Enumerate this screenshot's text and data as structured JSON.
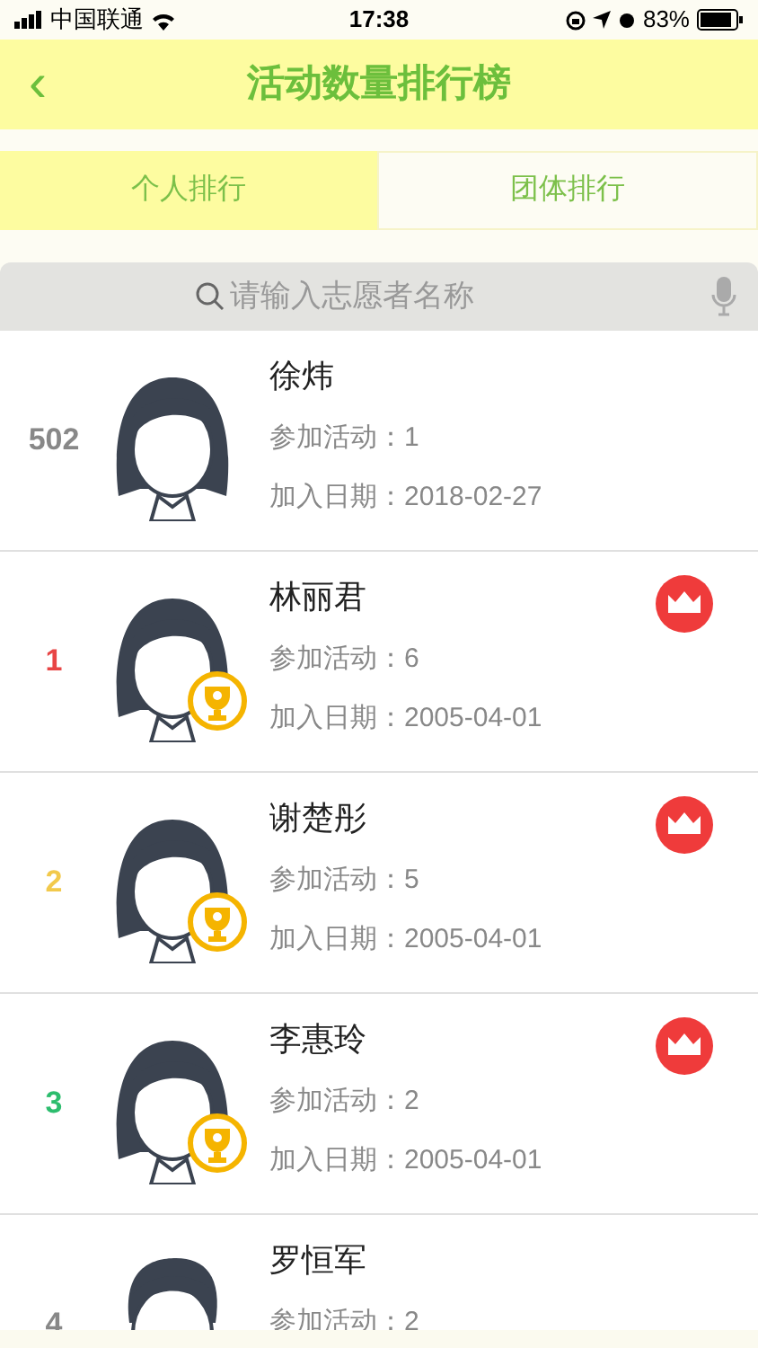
{
  "status_bar": {
    "carrier": "中国联通",
    "time": "17:38",
    "battery": "83%"
  },
  "header": {
    "back": "‹",
    "title": "活动数量排行榜"
  },
  "tabs": [
    {
      "label": "个人排行",
      "selected": true
    },
    {
      "label": "团体排行",
      "selected": false
    }
  ],
  "search": {
    "placeholder": "请输入志愿者名称"
  },
  "rows": [
    {
      "rank": "502",
      "color": "#888888",
      "kind": "female",
      "trophy": false,
      "crown": false,
      "name": "徐炜",
      "activities": "参加活动：1",
      "joined": "加入日期：2018-02-27"
    },
    {
      "rank": "1",
      "color": "#e84545",
      "kind": "female",
      "trophy": true,
      "crown": true,
      "name": "林丽君",
      "activities": "参加活动：6",
      "joined": "加入日期：2005-04-01"
    },
    {
      "rank": "2",
      "color": "#f2c94c",
      "kind": "female",
      "trophy": true,
      "crown": true,
      "name": "谢楚彤",
      "activities": "参加活动：5",
      "joined": "加入日期：2005-04-01"
    },
    {
      "rank": "3",
      "color": "#2dbd6e",
      "kind": "female",
      "trophy": true,
      "crown": true,
      "name": "李惠玲",
      "activities": "参加活动：2",
      "joined": "加入日期：2005-04-01"
    },
    {
      "rank": "4",
      "color": "#888888",
      "kind": "male",
      "trophy": false,
      "crown": false,
      "name": "罗恒军",
      "activities": "参加活动：2"
    }
  ]
}
